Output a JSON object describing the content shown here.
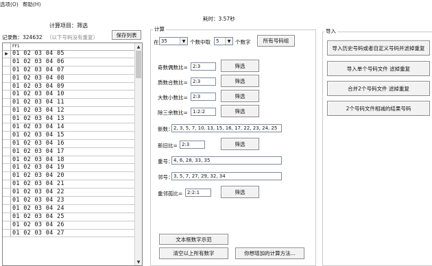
{
  "menu": {
    "options": "选项(O)",
    "help": "帮助(H)"
  },
  "elapsed": "耗时：3.57秒",
  "left": {
    "calc_item": "计算项目：筛选",
    "record_count": "记录数：324632",
    "no_repeat_note": "（以下号码没有重复）",
    "save_list": "保存列表",
    "column_header": "FF1",
    "rows": [
      "01 02 03 04 05",
      "01 02 03 04 06",
      "01 02 03 04 07",
      "01 02 03 04 08",
      "01 02 03 04 09",
      "01 02 03 04 10",
      "01 02 03 04 11",
      "01 02 03 04 12",
      "01 02 03 04 13",
      "01 02 03 04 14",
      "01 02 03 04 15",
      "01 02 03 04 16",
      "01 02 03 04 17",
      "01 02 03 04 18",
      "01 02 03 04 19",
      "01 02 03 04 20",
      "01 02 03 04 21",
      "01 02 03 04 22",
      "01 02 03 04 23",
      "01 02 03 04 24",
      "01 02 03 04 25",
      "01 02 03 04 26",
      "01 02 03 04 27"
    ],
    "current_row_marker": "▶"
  },
  "calc": {
    "title": "计算",
    "in_label": "在",
    "n_value": "35",
    "choose_label": "个数中取",
    "k_value": "5",
    "digits_label": "个数字",
    "all_numbers_button": "所有号码组",
    "filter_label": "筛选",
    "odd_even": {
      "label": "奇数偶数比=",
      "value": "2:3"
    },
    "prime_composite": {
      "label": "质数合数比=",
      "value": "2:3"
    },
    "big_small": {
      "label": "大数小数比=",
      "value": "2:3"
    },
    "mod3": {
      "label": "除三余数比=",
      "value": "1:2:2"
    },
    "new_numbers": {
      "label": "新数：",
      "value": "2, 3, 5, 7, 10, 13, 15, 16, 17, 22, 23, 24, 25"
    },
    "new_old": {
      "label": "新旧比=",
      "value": "2:3"
    },
    "repeat": {
      "label": "重号：",
      "value": "4, 6, 28, 33, 35"
    },
    "neighbor": {
      "label": "邻号：",
      "value": "3, 5, 7, 27, 29, 32, 34"
    },
    "repeat_neighbor_isolated": {
      "label": "重邻孤比=",
      "value": "2:2:1"
    },
    "text_box_demo_button": "文本框数字示范",
    "clear_all_button": "清空以上所有数字",
    "add_method_button": "你想增加的计算方法..."
  },
  "import": {
    "title": "导入",
    "import_history_button": "导入历史号码或者自定义号码并滤掉重复",
    "import_single_button": "导入单个号码文件 滤掉重复",
    "merge_two_button": "合并2个号码文件 滤掉重复",
    "subtract_two_button": "2个号码文件相减的结果号码"
  },
  "icons": {
    "dropdown": "dropdown-arrow-icon",
    "row_pointer": "row-pointer-icon",
    "scroll_up": "scroll-up-icon",
    "scroll_down": "scroll-down-icon"
  }
}
